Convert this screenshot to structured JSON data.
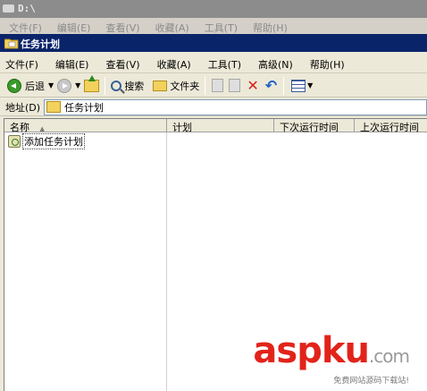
{
  "background_window": {
    "title": "D:\\",
    "menu": [
      "文件(F)",
      "编辑(E)",
      "查看(V)",
      "收藏(A)",
      "工具(T)",
      "帮助(H)"
    ]
  },
  "window": {
    "title": "任务计划"
  },
  "menubar": [
    "文件(F)",
    "编辑(E)",
    "查看(V)",
    "收藏(A)",
    "工具(T)",
    "高级(N)",
    "帮助(H)"
  ],
  "toolbar": {
    "back_label": "后退",
    "search_label": "搜索",
    "folders_label": "文件夹"
  },
  "address": {
    "label": "地址(D)",
    "value": "任务计划"
  },
  "list": {
    "columns": [
      "名称",
      "计划",
      "下次运行时间",
      "上次运行时间"
    ],
    "items": [
      "添加任务计划"
    ]
  },
  "watermark": {
    "text": "aspku",
    "suffix": ".com",
    "subtitle": "免费网站源码下载站!"
  },
  "colors": {
    "title_active": "#0a246a",
    "title_inactive": "#8c8c8c",
    "chrome": "#ece9d8",
    "watermark": "#e2231a"
  }
}
